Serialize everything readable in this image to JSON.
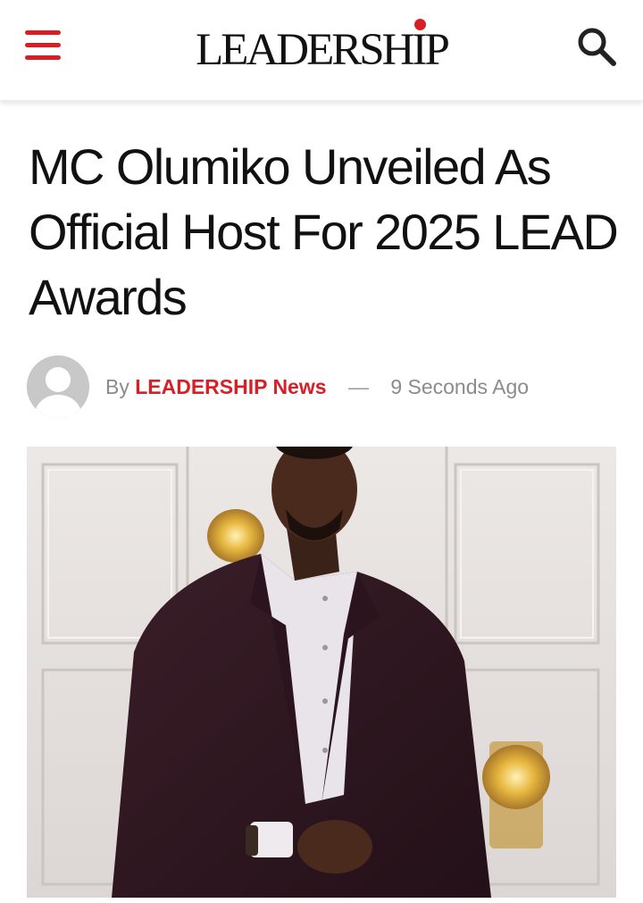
{
  "header": {
    "menu_icon": "hamburger-menu-icon",
    "logo_text": "LEADERSHIP",
    "search_icon": "search-icon",
    "accent_color": "#d91f26"
  },
  "article": {
    "headline": "MC Olumiko Unveiled As Official Host For 2025 LEAD Awards",
    "byline": {
      "avatar_icon": "user-avatar-icon",
      "by_label": "By",
      "author": "LEADERSHIP News",
      "separator": "—",
      "timestamp": "9 Seconds Ago"
    },
    "featured_image": "photo of man in dark suit and white shirt standing in front of white panelled wall with gold wall lamps"
  }
}
